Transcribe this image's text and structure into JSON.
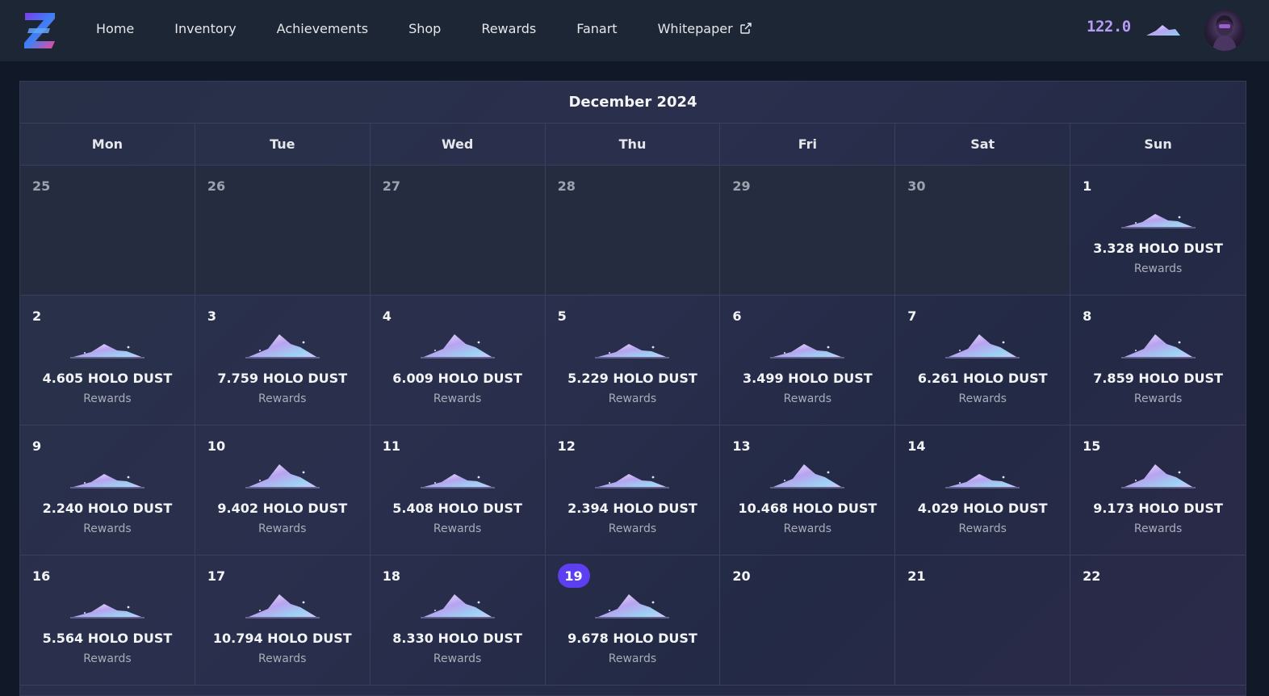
{
  "nav": {
    "links": [
      "Home",
      "Inventory",
      "Achievements",
      "Shop",
      "Rewards",
      "Fanart",
      "Whitepaper"
    ],
    "balance": "122.0"
  },
  "calendar": {
    "title": "December 2024",
    "weekdays": [
      "Mon",
      "Tue",
      "Wed",
      "Thu",
      "Fri",
      "Sat",
      "Sun"
    ],
    "reward_label": "Rewards",
    "currency": "HOLO DUST",
    "today": "19",
    "days": [
      {
        "num": "25",
        "muted": true
      },
      {
        "num": "26",
        "muted": true
      },
      {
        "num": "27",
        "muted": true
      },
      {
        "num": "28",
        "muted": true
      },
      {
        "num": "29",
        "muted": true
      },
      {
        "num": "30",
        "muted": true
      },
      {
        "num": "1",
        "amount": "3.328 HOLO DUST",
        "size": "small"
      },
      {
        "num": "2",
        "amount": "4.605 HOLO DUST",
        "size": "small"
      },
      {
        "num": "3",
        "amount": "7.759 HOLO DUST",
        "size": "large"
      },
      {
        "num": "4",
        "amount": "6.009 HOLO DUST",
        "size": "large"
      },
      {
        "num": "5",
        "amount": "5.229 HOLO DUST",
        "size": "small"
      },
      {
        "num": "6",
        "amount": "3.499 HOLO DUST",
        "size": "small"
      },
      {
        "num": "7",
        "amount": "6.261 HOLO DUST",
        "size": "large"
      },
      {
        "num": "8",
        "amount": "7.859 HOLO DUST",
        "size": "large"
      },
      {
        "num": "9",
        "amount": "2.240 HOLO DUST",
        "size": "small"
      },
      {
        "num": "10",
        "amount": "9.402 HOLO DUST",
        "size": "large"
      },
      {
        "num": "11",
        "amount": "5.408 HOLO DUST",
        "size": "small"
      },
      {
        "num": "12",
        "amount": "2.394 HOLO DUST",
        "size": "small"
      },
      {
        "num": "13",
        "amount": "10.468 HOLO DUST",
        "size": "large"
      },
      {
        "num": "14",
        "amount": "4.029 HOLO DUST",
        "size": "small"
      },
      {
        "num": "15",
        "amount": "9.173 HOLO DUST",
        "size": "large"
      },
      {
        "num": "16",
        "amount": "5.564 HOLO DUST",
        "size": "small"
      },
      {
        "num": "17",
        "amount": "10.794 HOLO DUST",
        "size": "large"
      },
      {
        "num": "18",
        "amount": "8.330 HOLO DUST",
        "size": "large"
      },
      {
        "num": "19",
        "amount": "9.678 HOLO DUST",
        "size": "large"
      },
      {
        "num": "20"
      },
      {
        "num": "21"
      },
      {
        "num": "22"
      }
    ]
  }
}
